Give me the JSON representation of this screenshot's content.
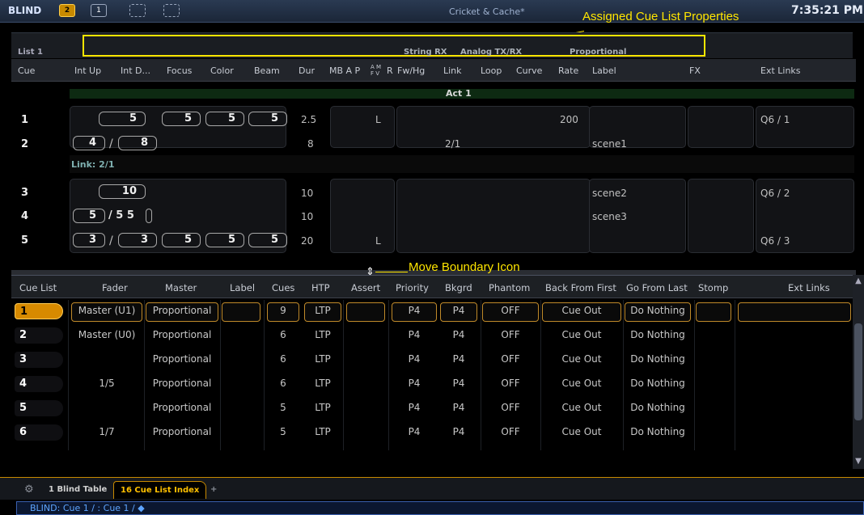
{
  "topbar": {
    "mode": "BLIND",
    "buttons": [
      "2",
      "1"
    ],
    "show_name": "Cricket & Cache*",
    "clock": "7:35:21 PM"
  },
  "annotations": {
    "assigned": "Assigned Cue List Properties",
    "boundary": "Move Boundary Icon"
  },
  "list": {
    "name": "List 1",
    "props": [
      "String RX",
      "Analog TX/RX",
      "Proportional"
    ]
  },
  "cue_headers": {
    "cue": "Cue",
    "int_up": "Int Up",
    "int_down": "Int D...",
    "focus": "Focus",
    "color": "Color",
    "beam": "Beam",
    "dur": "Dur",
    "mbap": "MB A P",
    "am": "A M",
    "fv": "F V",
    "r": "R",
    "fwhg": "Fw/Hg",
    "link": "Link",
    "loop": "Loop",
    "curve": "Curve",
    "rate": "Rate",
    "label": "Label",
    "fx": "FX",
    "ext": "Ext Links"
  },
  "act_label": "Act 1",
  "link_label": "Link: 2/1",
  "cues": {
    "c1": {
      "num": "1",
      "intup": "5",
      "focus": "5",
      "color": "5",
      "beam": "5",
      "dur": "2.5",
      "mark": "L",
      "rate": "200",
      "ext": "Q6 / 1"
    },
    "c2": {
      "num": "2",
      "intup": "4",
      "sep": "/",
      "intdn": "8",
      "dur": "8",
      "link": "2/1",
      "label": "scene1"
    },
    "c3": {
      "num": "3",
      "intup": "10",
      "dur": "10",
      "label": "scene2",
      "ext": "Q6 / 2"
    },
    "c4": {
      "num": "4",
      "intup": "5",
      "intdn": "/ 5 5",
      "dur": "10",
      "label": "scene3"
    },
    "c5": {
      "num": "5",
      "intup": "3",
      "sep": "/",
      "intdn": "3",
      "focus": "5",
      "color": "5",
      "beam": "5",
      "dur": "20",
      "mark": "L",
      "ext": "Q6 / 3"
    }
  },
  "index_headers": {
    "cuelist": "Cue List",
    "fader": "Fader",
    "master": "Master",
    "label": "Label",
    "cues": "Cues",
    "htp": "HTP",
    "assert": "Assert",
    "priority": "Priority",
    "bkgrd": "Bkgrd",
    "phantom": "Phantom",
    "backfirst": "Back From First",
    "golast": "Go From Last",
    "stomp": "Stomp",
    "ext": "Ext Links"
  },
  "index_rows": [
    {
      "list": "1",
      "fader": "Master (U1)",
      "master": "Proportional",
      "cues": "9",
      "htp": "LTP",
      "priority": "P4",
      "bkgrd": "P4",
      "phantom": "OFF",
      "back": "Cue Out",
      "go": "Do Nothing"
    },
    {
      "list": "2",
      "fader": "Master (U0)",
      "master": "Proportional",
      "cues": "6",
      "htp": "LTP",
      "priority": "P4",
      "bkgrd": "P4",
      "phantom": "OFF",
      "back": "Cue Out",
      "go": "Do Nothing"
    },
    {
      "list": "3",
      "fader": "",
      "master": "Proportional",
      "cues": "6",
      "htp": "LTP",
      "priority": "P4",
      "bkgrd": "P4",
      "phantom": "OFF",
      "back": "Cue Out",
      "go": "Do Nothing"
    },
    {
      "list": "4",
      "fader": "1/5",
      "master": "Proportional",
      "cues": "6",
      "htp": "LTP",
      "priority": "P4",
      "bkgrd": "P4",
      "phantom": "OFF",
      "back": "Cue Out",
      "go": "Do Nothing"
    },
    {
      "list": "5",
      "fader": "",
      "master": "Proportional",
      "cues": "5",
      "htp": "LTP",
      "priority": "P4",
      "bkgrd": "P4",
      "phantom": "OFF",
      "back": "Cue Out",
      "go": "Do Nothing"
    },
    {
      "list": "6",
      "fader": "1/7",
      "master": "Proportional",
      "cues": "5",
      "htp": "LTP",
      "priority": "P4",
      "bkgrd": "P4",
      "phantom": "OFF",
      "back": "Cue Out",
      "go": "Do Nothing"
    }
  ],
  "tabs": {
    "t1": "1 Blind Table",
    "t2": "16 Cue List Index",
    "plus": "+"
  },
  "command_line": "BLIND: Cue  1 / :  Cue 1 / ◆"
}
